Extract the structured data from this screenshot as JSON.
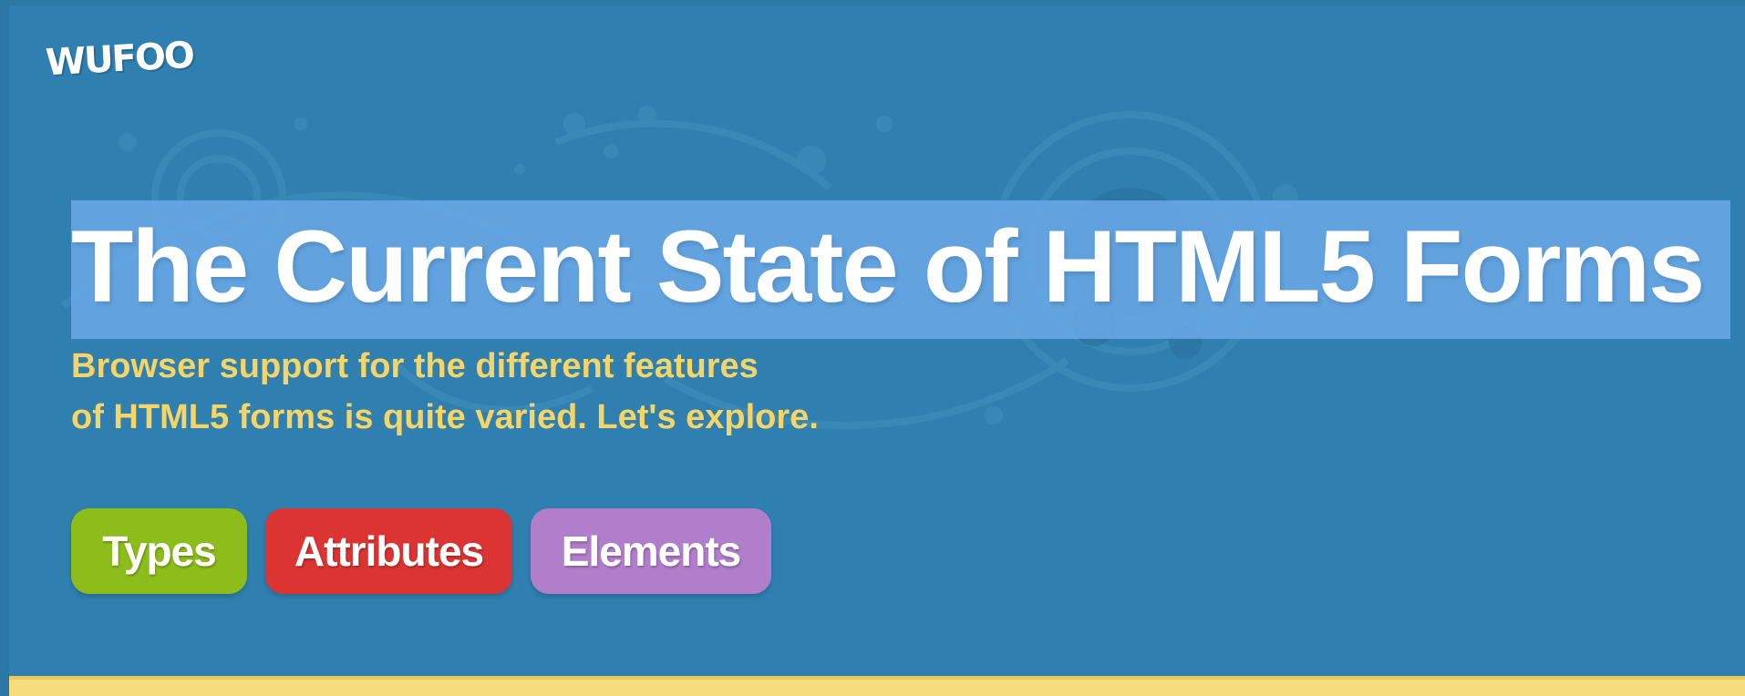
{
  "logo": {
    "text": "WUFOO"
  },
  "hero": {
    "title": "The Current State of HTML5 Forms",
    "subtitle_line1": "Browser support for the different features",
    "subtitle_line2": "of HTML5 forms is quite varied. Let's explore."
  },
  "nav_buttons": [
    {
      "label": "Types",
      "color": "#8dbd1a"
    },
    {
      "label": "Attributes",
      "color": "#db3432"
    },
    {
      "label": "Elements",
      "color": "#b17ecb"
    }
  ],
  "colors": {
    "background": "#2f80b1",
    "title_highlight": "#6aa8e8",
    "subtitle": "#f6d566",
    "bottom_band": "#f8dd7f"
  }
}
